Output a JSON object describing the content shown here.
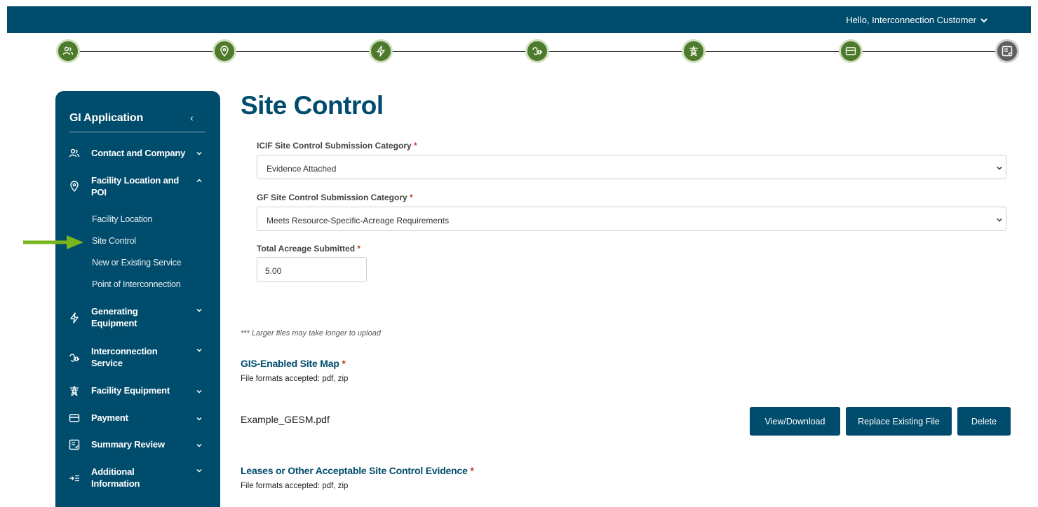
{
  "header": {
    "greeting": "Hello, Interconnection Customer",
    "bar_color": "#004c6c",
    "chevron_icon": "chevron-down-icon"
  },
  "stepper": {
    "steps": [
      {
        "icon": "users-icon",
        "state": "complete"
      },
      {
        "icon": "map-pin-icon",
        "state": "complete"
      },
      {
        "icon": "lightning-icon",
        "state": "complete"
      },
      {
        "icon": "plug-icon",
        "state": "complete"
      },
      {
        "icon": "transmission-tower-icon",
        "state": "complete"
      },
      {
        "icon": "credit-card-icon",
        "state": "complete"
      },
      {
        "icon": "checklist-icon",
        "state": "incomplete"
      }
    ],
    "complete_color": "#4e7a2b",
    "incomplete_color": "#5f5f5f"
  },
  "sidebar": {
    "title": "GI Application",
    "collapse_glyph": "‹",
    "items": [
      {
        "label": "Contact and Company",
        "icon": "users-icon"
      },
      {
        "label": "Facility Location and POI",
        "icon": "map-pin-icon",
        "expanded": true
      },
      {
        "label": "Generating Equipment",
        "icon": "lightning-icon"
      },
      {
        "label": "Interconnection Service",
        "icon": "plug-icon"
      },
      {
        "label": "Facility Equipment",
        "icon": "transmission-tower-icon"
      },
      {
        "label": "Payment",
        "icon": "credit-card-icon"
      },
      {
        "label": "Summary Review",
        "icon": "checklist-icon"
      },
      {
        "label": "Additional Information",
        "icon": "arrow-list-icon"
      }
    ],
    "subitems": [
      {
        "label": "Facility Location"
      },
      {
        "label": "Site Control",
        "active": true
      },
      {
        "label": "New or Existing Service"
      },
      {
        "label": "Point of Interconnection"
      }
    ]
  },
  "annotation": {
    "arrow_color": "#7ab51d"
  },
  "main": {
    "title": "Site Control",
    "required_mark": "*",
    "fields": {
      "icif_label": "ICIF Site Control Submission Category",
      "icif_value": "Evidence Attached",
      "gf_label": "GF Site Control Submission Category",
      "gf_value": "Meets Resource-Specific-Acreage Requirements",
      "acreage_label": "Total Acreage Submitted",
      "acreage_value": "5.00"
    },
    "upload_note": "*** Larger files may take longer to upload",
    "gis_section": {
      "title": "GIS-Enabled Site Map",
      "formats": "File formats accepted: pdf, zip",
      "file_name": "Example_GESM.pdf",
      "view_label": "View/Download",
      "replace_label": "Replace Existing File",
      "delete_label": "Delete"
    },
    "lease_section": {
      "title": "Leases or Other Acceptable Site Control Evidence",
      "formats": "File formats accepted: pdf, zip"
    }
  }
}
